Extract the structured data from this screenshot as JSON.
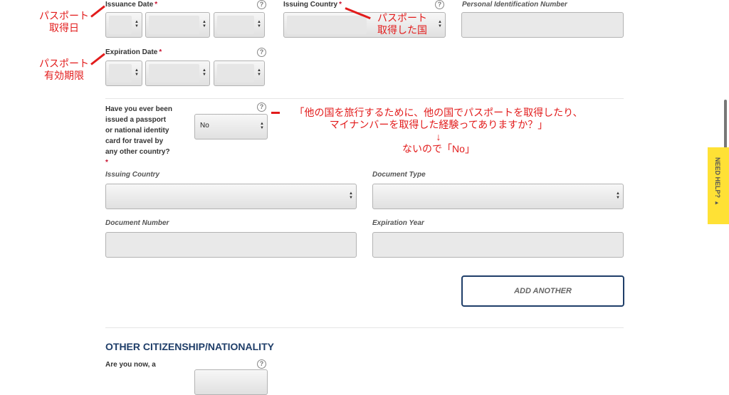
{
  "fields": {
    "issuance_date": {
      "label": "Issuance Date",
      "required": "*"
    },
    "issuing_country": {
      "label": "Issuing Country",
      "required": "*"
    },
    "personal_id": {
      "label": "Personal Identification Number"
    },
    "expiration_date": {
      "label": "Expiration Date",
      "required": "*"
    },
    "other_country_question": {
      "lines": [
        "Have you ever been",
        "issued a passport",
        "or national identity",
        "card for travel by",
        "any other country?"
      ],
      "required": "*",
      "value": "No"
    },
    "other_issuing_country": {
      "label": "Issuing Country"
    },
    "document_type": {
      "label": "Document Type"
    },
    "document_number": {
      "label": "Document Number"
    },
    "expiration_year": {
      "label": "Expiration Year"
    }
  },
  "buttons": {
    "add_another": "ADD ANOTHER"
  },
  "section": {
    "title": "OTHER CITIZENSHIP/NATIONALITY",
    "question_partial": "Are you now, a"
  },
  "help_icon": "?",
  "need_help": {
    "label": "NEED HELP?",
    "arrow": "▸"
  },
  "annotations": {
    "issuance": [
      "パスポート",
      "取得日"
    ],
    "expiration": [
      "パスポート",
      "有効期限"
    ],
    "country": [
      "パスポート",
      "取得した国"
    ],
    "question_main": [
      "「他の国を旅行するために、他の国でパスポートを取得したり、",
      "マイナンバーを取得した経験ってありますか？」"
    ],
    "down_arrow": "↓",
    "answer": "ないので「No」"
  },
  "colors": {
    "annotation": "#e21b1b",
    "accent": "#1f3e69",
    "need_help_bg": "#ffe135"
  }
}
